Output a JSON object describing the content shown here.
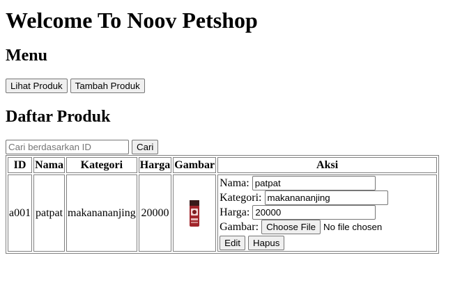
{
  "header": {
    "title": "Welcome To Noov Petshop"
  },
  "menu": {
    "heading": "Menu",
    "buttons": [
      "Lihat Produk",
      "Tambah Produk"
    ]
  },
  "product_list": {
    "heading": "Daftar Produk",
    "search": {
      "placeholder": "Cari berdasarkan ID",
      "value": "",
      "button_label": "Cari"
    },
    "columns": [
      "ID",
      "Nama",
      "Kategori",
      "Harga",
      "Gambar",
      "Aksi"
    ],
    "rows": [
      {
        "id": "a001",
        "nama": "patpat",
        "kategori": "makanananjing",
        "harga": "20000",
        "gambar_icon": "dog-food-bag-image",
        "form": {
          "nama_label": "Nama:",
          "nama_value": "patpat",
          "kategori_label": "Kategori:",
          "kategori_value": "makanananjing",
          "harga_label": "Harga:",
          "harga_value": "20000",
          "gambar_label": "Gambar:",
          "file_button": "Choose File",
          "file_status": "No file chosen",
          "edit_button": "Edit",
          "hapus_button": "Hapus"
        }
      }
    ]
  },
  "colors": {
    "product_bag_red": "#a0252b",
    "product_bag_dark": "#3a1a1a"
  }
}
